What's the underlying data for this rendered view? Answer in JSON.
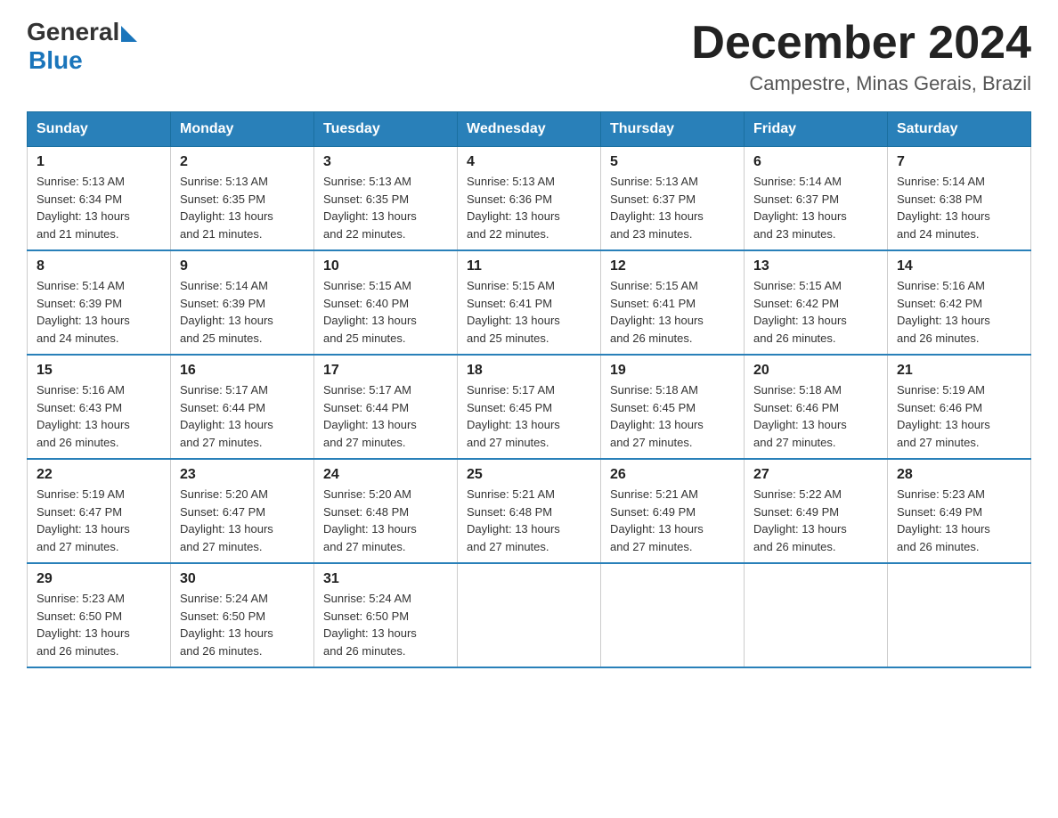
{
  "logo": {
    "general": "General",
    "blue": "Blue"
  },
  "title": "December 2024",
  "location": "Campestre, Minas Gerais, Brazil",
  "days_of_week": [
    "Sunday",
    "Monday",
    "Tuesday",
    "Wednesday",
    "Thursday",
    "Friday",
    "Saturday"
  ],
  "weeks": [
    [
      {
        "day": "1",
        "sunrise": "5:13 AM",
        "sunset": "6:34 PM",
        "daylight": "13 hours and 21 minutes."
      },
      {
        "day": "2",
        "sunrise": "5:13 AM",
        "sunset": "6:35 PM",
        "daylight": "13 hours and 21 minutes."
      },
      {
        "day": "3",
        "sunrise": "5:13 AM",
        "sunset": "6:35 PM",
        "daylight": "13 hours and 22 minutes."
      },
      {
        "day": "4",
        "sunrise": "5:13 AM",
        "sunset": "6:36 PM",
        "daylight": "13 hours and 22 minutes."
      },
      {
        "day": "5",
        "sunrise": "5:13 AM",
        "sunset": "6:37 PM",
        "daylight": "13 hours and 23 minutes."
      },
      {
        "day": "6",
        "sunrise": "5:14 AM",
        "sunset": "6:37 PM",
        "daylight": "13 hours and 23 minutes."
      },
      {
        "day": "7",
        "sunrise": "5:14 AM",
        "sunset": "6:38 PM",
        "daylight": "13 hours and 24 minutes."
      }
    ],
    [
      {
        "day": "8",
        "sunrise": "5:14 AM",
        "sunset": "6:39 PM",
        "daylight": "13 hours and 24 minutes."
      },
      {
        "day": "9",
        "sunrise": "5:14 AM",
        "sunset": "6:39 PM",
        "daylight": "13 hours and 25 minutes."
      },
      {
        "day": "10",
        "sunrise": "5:15 AM",
        "sunset": "6:40 PM",
        "daylight": "13 hours and 25 minutes."
      },
      {
        "day": "11",
        "sunrise": "5:15 AM",
        "sunset": "6:41 PM",
        "daylight": "13 hours and 25 minutes."
      },
      {
        "day": "12",
        "sunrise": "5:15 AM",
        "sunset": "6:41 PM",
        "daylight": "13 hours and 26 minutes."
      },
      {
        "day": "13",
        "sunrise": "5:15 AM",
        "sunset": "6:42 PM",
        "daylight": "13 hours and 26 minutes."
      },
      {
        "day": "14",
        "sunrise": "5:16 AM",
        "sunset": "6:42 PM",
        "daylight": "13 hours and 26 minutes."
      }
    ],
    [
      {
        "day": "15",
        "sunrise": "5:16 AM",
        "sunset": "6:43 PM",
        "daylight": "13 hours and 26 minutes."
      },
      {
        "day": "16",
        "sunrise": "5:17 AM",
        "sunset": "6:44 PM",
        "daylight": "13 hours and 27 minutes."
      },
      {
        "day": "17",
        "sunrise": "5:17 AM",
        "sunset": "6:44 PM",
        "daylight": "13 hours and 27 minutes."
      },
      {
        "day": "18",
        "sunrise": "5:17 AM",
        "sunset": "6:45 PM",
        "daylight": "13 hours and 27 minutes."
      },
      {
        "day": "19",
        "sunrise": "5:18 AM",
        "sunset": "6:45 PM",
        "daylight": "13 hours and 27 minutes."
      },
      {
        "day": "20",
        "sunrise": "5:18 AM",
        "sunset": "6:46 PM",
        "daylight": "13 hours and 27 minutes."
      },
      {
        "day": "21",
        "sunrise": "5:19 AM",
        "sunset": "6:46 PM",
        "daylight": "13 hours and 27 minutes."
      }
    ],
    [
      {
        "day": "22",
        "sunrise": "5:19 AM",
        "sunset": "6:47 PM",
        "daylight": "13 hours and 27 minutes."
      },
      {
        "day": "23",
        "sunrise": "5:20 AM",
        "sunset": "6:47 PM",
        "daylight": "13 hours and 27 minutes."
      },
      {
        "day": "24",
        "sunrise": "5:20 AM",
        "sunset": "6:48 PM",
        "daylight": "13 hours and 27 minutes."
      },
      {
        "day": "25",
        "sunrise": "5:21 AM",
        "sunset": "6:48 PM",
        "daylight": "13 hours and 27 minutes."
      },
      {
        "day": "26",
        "sunrise": "5:21 AM",
        "sunset": "6:49 PM",
        "daylight": "13 hours and 27 minutes."
      },
      {
        "day": "27",
        "sunrise": "5:22 AM",
        "sunset": "6:49 PM",
        "daylight": "13 hours and 26 minutes."
      },
      {
        "day": "28",
        "sunrise": "5:23 AM",
        "sunset": "6:49 PM",
        "daylight": "13 hours and 26 minutes."
      }
    ],
    [
      {
        "day": "29",
        "sunrise": "5:23 AM",
        "sunset": "6:50 PM",
        "daylight": "13 hours and 26 minutes."
      },
      {
        "day": "30",
        "sunrise": "5:24 AM",
        "sunset": "6:50 PM",
        "daylight": "13 hours and 26 minutes."
      },
      {
        "day": "31",
        "sunrise": "5:24 AM",
        "sunset": "6:50 PM",
        "daylight": "13 hours and 26 minutes."
      },
      null,
      null,
      null,
      null
    ]
  ],
  "labels": {
    "sunrise": "Sunrise:",
    "sunset": "Sunset:",
    "daylight": "Daylight:"
  }
}
